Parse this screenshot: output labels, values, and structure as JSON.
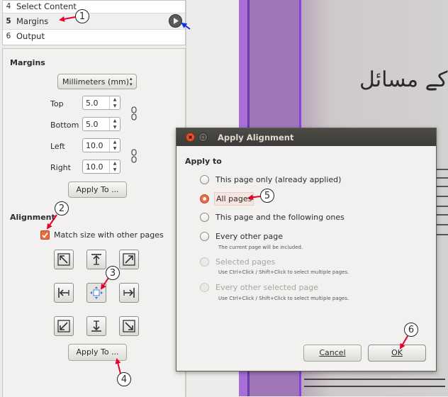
{
  "steps": [
    {
      "num": "4",
      "label": "Select Content"
    },
    {
      "num": "5",
      "label": "Margins"
    },
    {
      "num": "6",
      "label": "Output"
    }
  ],
  "margins": {
    "title": "Margins",
    "unit": "Millimeters (mm)",
    "top_label": "Top",
    "top_value": "5.0",
    "bottom_label": "Bottom",
    "bottom_value": "5.0",
    "left_label": "Left",
    "left_value": "10.0",
    "right_label": "Right",
    "right_value": "10.0",
    "apply_label": "Apply To ..."
  },
  "alignment": {
    "title": "Alignment",
    "match_label": "Match size with other pages",
    "match_checked": true,
    "apply_label": "Apply To ..."
  },
  "dialog": {
    "title": "Apply Alignment",
    "heading": "Apply to",
    "options": [
      {
        "label": "This page only (already applied)",
        "enabled": true,
        "selected": false
      },
      {
        "label": "All pages",
        "enabled": true,
        "selected": true
      },
      {
        "label": "This page and the following ones",
        "enabled": true,
        "selected": false
      },
      {
        "label": "Every other page",
        "enabled": true,
        "selected": false,
        "hint": "The current page will be included."
      },
      {
        "label": "Selected pages",
        "enabled": false,
        "selected": false,
        "hint": "Use Ctrl+Click / Shift+Click to select multiple pages."
      },
      {
        "label": "Every other selected page",
        "enabled": false,
        "selected": false,
        "hint": "Use Ctrl+Click / Shift+Click to select multiple pages."
      }
    ],
    "cancel_label": "Cancel",
    "ok_label": "OK"
  },
  "document": {
    "heading_text": "کے مسائل"
  },
  "callouts": [
    "1",
    "2",
    "3",
    "4",
    "5",
    "6"
  ],
  "colors": {
    "accent": "#ea6a3e",
    "titlebar": "#3c3b37",
    "arrow": "#e8002a",
    "selection": "#9b59d6"
  }
}
